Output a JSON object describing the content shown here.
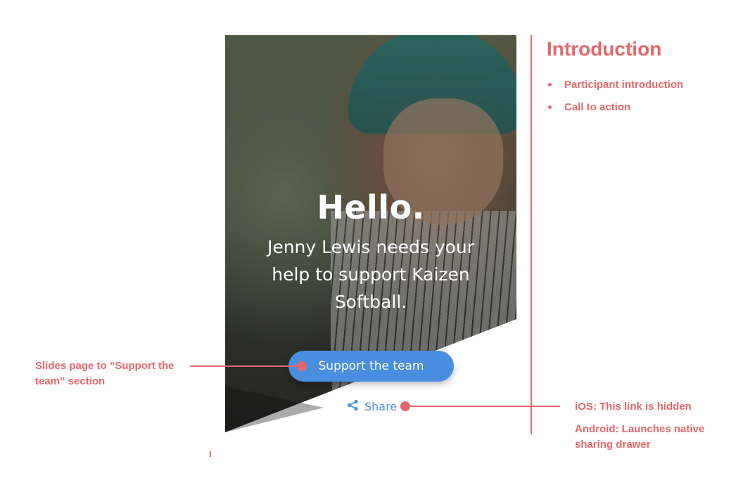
{
  "hero": {
    "title": "Hello.",
    "subtitle": "Jenny Lewis needs your help to support Kaizen Softball.",
    "cta_label": "Support the team",
    "share_label": "Share",
    "share_icon": "share-icon",
    "accent_color": "#4a8ee0"
  },
  "annotations": {
    "color": "#e4676c",
    "intro_title": "Introduction",
    "intro_items": [
      "Participant introduction",
      "Call to action"
    ],
    "cta_note": "Slides page to “Support the team” section",
    "ios_note": "iOS: This link is hidden",
    "android_note": "Android: Launches native sharing drawer"
  }
}
